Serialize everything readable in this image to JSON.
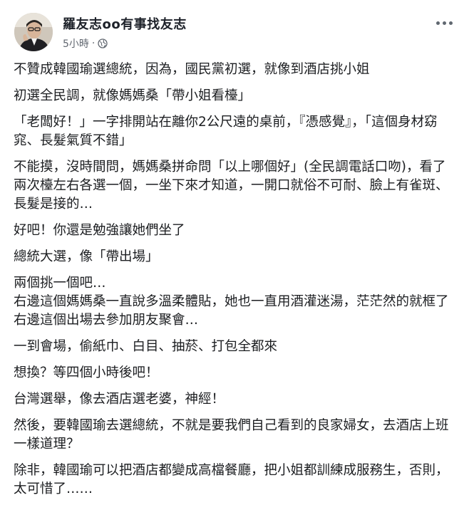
{
  "post": {
    "author": "羅友志oo有事找友志",
    "time": "5小時",
    "separator": "·",
    "privacy_icon": "globe-icon",
    "more_icon": "more-options-icon",
    "paragraphs": [
      "不贊成韓國瑜選總統，因為，國民黨初選，就像到酒店挑小姐",
      "初選全民調，就像媽媽桑「帶小姐看檯」",
      "「老闆好！」一字排開站在離你2公尺遠的桌前，『憑感覺』，「這個身材窈窕、長髮氣質不錯」",
      "不能摸，沒時間問，媽媽桑拼命問「以上哪個好」(全民調電話口吻)，看了兩次檯左右各選一個，一坐下來才知道，一開口就俗不可耐、臉上有雀斑、長髮是接的…",
      "好吧！你還是勉強讓她們坐了",
      "總統大選，像「帶出場」",
      "兩個挑一個吧…",
      "右邊這個媽媽桑一直說多溫柔體貼，她也一直用酒灌迷湯，茫茫然的就框了右邊這個出場去參加朋友聚會…",
      "一到會場，偷紙巾、白目、抽菸、打包全都來",
      "想換？等四個小時後吧！",
      "台灣選舉，像去酒店選老婆，神經！",
      "然後，要韓國瑜去選總統，不就是要我們自己看到的良家婦女，去酒店上班一樣道理？",
      "除非，韓國瑜可以把酒店都變成高檔餐廳，把小姐都訓練成服務生，否則，太可惜了……"
    ]
  },
  "colors": {
    "author": "#1d2129",
    "meta": "#616770",
    "text": "#1c1e21"
  }
}
